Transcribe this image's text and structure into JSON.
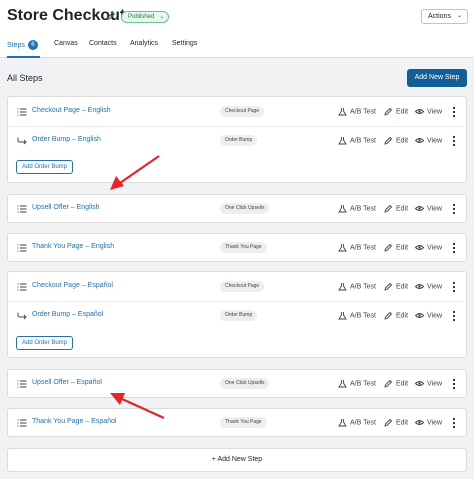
{
  "header": {
    "title": "Store Checkout",
    "status": "Published",
    "actions_label": "Actions"
  },
  "tabs": [
    {
      "label": "Steps",
      "count": "6",
      "active": true
    },
    {
      "label": "Canvas"
    },
    {
      "label": "Contacts"
    },
    {
      "label": "Analytics"
    },
    {
      "label": "Settings"
    }
  ],
  "main": {
    "section_title": "All Steps",
    "add_new_step_label": "Add New Step",
    "add_new_step_bottom_label": "+ Add New Step",
    "add_order_bump_label": "Add Order Bump",
    "row_actions": {
      "ab_test": "A/B Test",
      "edit": "Edit",
      "view": "View"
    }
  },
  "groups": [
    {
      "rows": [
        {
          "name": "Checkout Page – English",
          "type": "Checkout Page",
          "icon": "list-icon"
        },
        {
          "name": "Order Bump – English",
          "type": "Order Bump",
          "icon": "arrow-return-icon"
        }
      ],
      "has_add_bump": true
    },
    {
      "rows": [
        {
          "name": "Upsell Offer – English",
          "type": "One Click Upsells",
          "icon": "list-icon"
        }
      ]
    },
    {
      "rows": [
        {
          "name": "Thank You Page – English",
          "type": "Thank You Page",
          "icon": "list-icon"
        }
      ]
    },
    {
      "rows": [
        {
          "name": "Checkout Page – Español",
          "type": "Checkout Page",
          "icon": "list-icon"
        },
        {
          "name": "Order Bump – Español",
          "type": "Order Bump",
          "icon": "arrow-return-icon"
        }
      ],
      "has_add_bump": true
    },
    {
      "rows": [
        {
          "name": "Upsell Offer – Español",
          "type": "One Click Upsells",
          "icon": "list-icon"
        }
      ]
    },
    {
      "rows": [
        {
          "name": "Thank You Page – Español",
          "type": "Thank You Page",
          "icon": "list-icon"
        }
      ]
    }
  ],
  "colors": {
    "accent": "#2271b1",
    "annotation_arrow": "#e3262b",
    "published": "#1a7f3c"
  }
}
